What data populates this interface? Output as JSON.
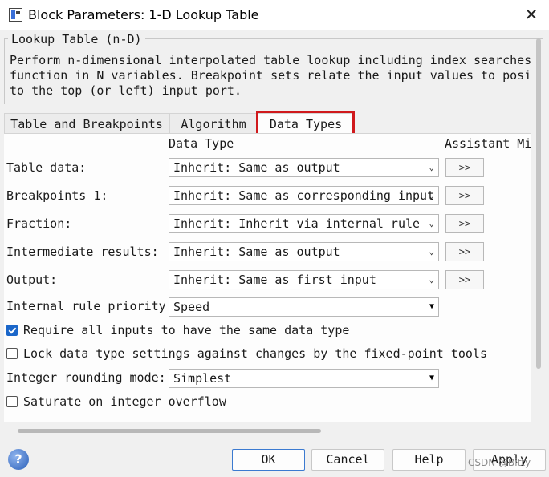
{
  "window": {
    "title": "Block Parameters: 1-D Lookup Table",
    "close_glyph": "✕",
    "icon": "simulink-block-icon"
  },
  "group": {
    "title": "Lookup Table (n-D)",
    "description": [
      "Perform n-dimensional interpolated table lookup including index searches. The",
      "function in N variables. Breakpoint sets relate the input values to positions",
      "to the top (or left) input port."
    ]
  },
  "tabs": [
    {
      "label": "Table and Breakpoints",
      "active": false
    },
    {
      "label": "Algorithm",
      "active": false
    },
    {
      "label": "Data Types",
      "active": true
    }
  ],
  "columns": {
    "data_type": "Data Type",
    "assistant": "Assistant Min"
  },
  "rows": [
    {
      "label": "Table data:",
      "value": "Inherit: Same as output",
      "button": ">>"
    },
    {
      "label": "Breakpoints 1:",
      "value": "Inherit: Same as corresponding input",
      "button": ">>"
    },
    {
      "label": "Fraction:",
      "value": "Inherit: Inherit via internal rule",
      "button": ">>"
    },
    {
      "label": "Intermediate results:",
      "value": "Inherit: Same as output",
      "button": ">>"
    },
    {
      "label": "Output:",
      "value": "Inherit: Same as first input",
      "button": ">>"
    }
  ],
  "rule_priority": {
    "label": "Internal rule priority:",
    "value": "Speed"
  },
  "checkboxes": {
    "same_type": {
      "label": "Require all inputs to have the same data type",
      "checked": true
    },
    "lock": {
      "label": "Lock data type settings against changes by the fixed-point tools",
      "checked": false
    },
    "saturate": {
      "label": "Saturate on integer overflow",
      "checked": false
    }
  },
  "rounding": {
    "label": "Integer rounding mode:",
    "value": "Simplest"
  },
  "buttons": {
    "ok": "OK",
    "cancel": "Cancel",
    "help": "Help",
    "apply": "Apply"
  },
  "help_glyph": "?",
  "dropdown_glyph": "⌄",
  "dropdown_solid_glyph": "▼",
  "watermark": "CSDN @Bitty",
  "colors": {
    "highlight": "#d0191c",
    "accent": "#1a66c9"
  }
}
